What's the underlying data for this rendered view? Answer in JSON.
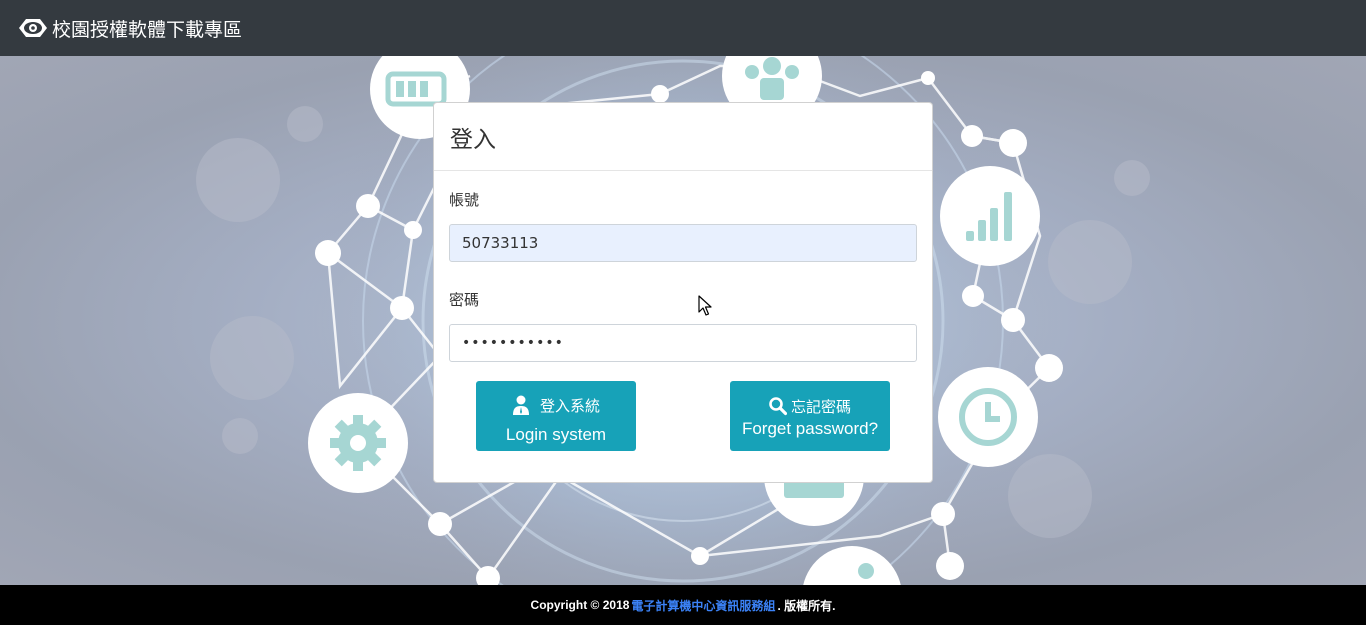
{
  "navbar": {
    "logo_icon": "eye-logo-icon",
    "title": "校園授權軟體下載專區"
  },
  "login_card": {
    "title": "登入",
    "account_label": "帳號",
    "account_value": "50733113",
    "password_label": "密碼",
    "password_value": "•••••••••••",
    "login_button": {
      "icon": "user-icon",
      "label_zh": "登入系統",
      "label_en": "Login system"
    },
    "forget_button": {
      "icon": "search-icon",
      "label_zh": "忘記密碼",
      "label_en": "Forget password?"
    }
  },
  "footer": {
    "copyright_prefix": "Copyright © 2018",
    "org_link": "電子計算機中心資訊服務組",
    "suffix": ". 版權所有."
  },
  "colors": {
    "navbar_bg": "#343a40",
    "button_bg": "#17a2b8",
    "footer_bg": "#000000",
    "link": "#3b82f6"
  }
}
